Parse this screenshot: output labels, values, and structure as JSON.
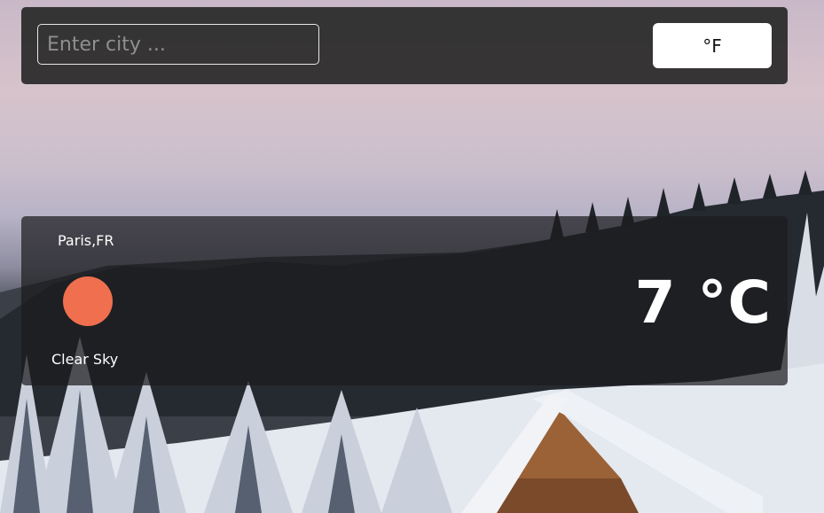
{
  "search": {
    "placeholder": "Enter city ...",
    "value": ""
  },
  "unit_toggle": {
    "label": "°F"
  },
  "weather": {
    "location": "Paris,FR",
    "icon": "sun-icon",
    "condition": "Clear Sky",
    "temperature": "7 °C"
  },
  "colors": {
    "sun": "#ef6f4e",
    "panel": "#282828",
    "button": "#ffffff"
  }
}
